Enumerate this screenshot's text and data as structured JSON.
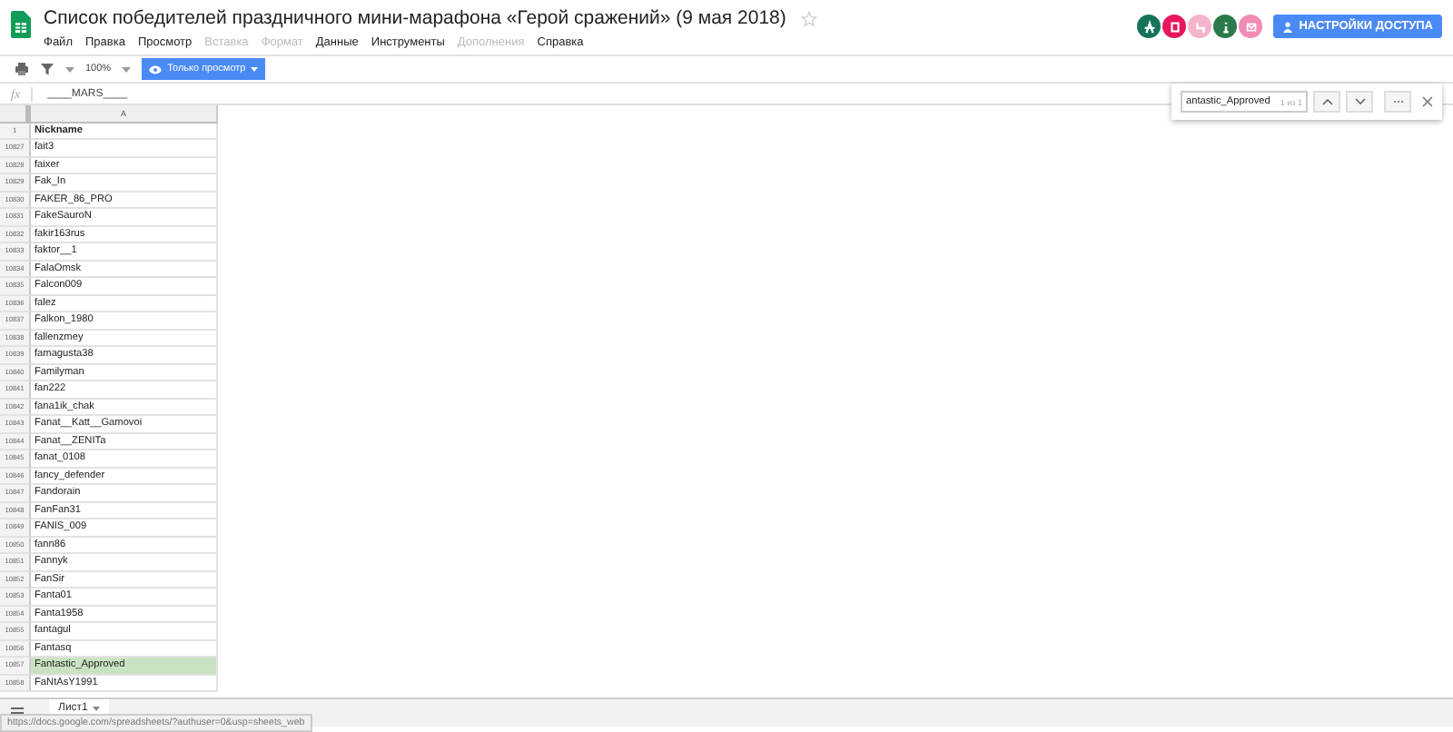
{
  "title": "Список победителей праздничного мини-марафона «Герой сражений» (9 мая 2018)",
  "menu": [
    {
      "label": "Файл",
      "disabled": false
    },
    {
      "label": "Правка",
      "disabled": false
    },
    {
      "label": "Просмотр",
      "disabled": false
    },
    {
      "label": "Вставка",
      "disabled": true
    },
    {
      "label": "Формат",
      "disabled": true
    },
    {
      "label": "Данные",
      "disabled": false
    },
    {
      "label": "Инструменты",
      "disabled": false
    },
    {
      "label": "Дополнения",
      "disabled": true
    },
    {
      "label": "Справка",
      "disabled": false
    }
  ],
  "avatars": [
    {
      "color": "#16735a"
    },
    {
      "color": "#e8175d"
    },
    {
      "color": "#f5b3cc"
    },
    {
      "color": "#2b7a4b"
    },
    {
      "color": "#f28bb4"
    }
  ],
  "share_button": "НАСТРОЙКИ ДОСТУПА",
  "toolbar": {
    "zoom": "100%",
    "mode": "Только просмотр"
  },
  "formula": {
    "fx": "fx",
    "value": "____MARS____"
  },
  "find": {
    "value": "antastic_Approved",
    "count": "1 из 1"
  },
  "sheet": {
    "column": "A",
    "header_row": {
      "number": "1",
      "value": "Nickname"
    },
    "rows": [
      {
        "number": "10827",
        "value": "fait3",
        "selected": false
      },
      {
        "number": "10828",
        "value": "faixer",
        "selected": false
      },
      {
        "number": "10829",
        "value": "Fak_In",
        "selected": false
      },
      {
        "number": "10830",
        "value": "FAKER_86_PRO",
        "selected": false
      },
      {
        "number": "10831",
        "value": "FakeSauroN",
        "selected": false
      },
      {
        "number": "10832",
        "value": "fakir163rus",
        "selected": false
      },
      {
        "number": "10833",
        "value": "faktor__1",
        "selected": false
      },
      {
        "number": "10834",
        "value": "FalaOmsk",
        "selected": false
      },
      {
        "number": "10835",
        "value": "Falcon009",
        "selected": false
      },
      {
        "number": "10836",
        "value": "falez",
        "selected": false
      },
      {
        "number": "10837",
        "value": "Falkon_1980",
        "selected": false
      },
      {
        "number": "10838",
        "value": "fallenzmey",
        "selected": false
      },
      {
        "number": "10839",
        "value": "famagusta38",
        "selected": false
      },
      {
        "number": "10840",
        "value": "Familyman",
        "selected": false
      },
      {
        "number": "10841",
        "value": "fan222",
        "selected": false
      },
      {
        "number": "10842",
        "value": "fana1ik_chak",
        "selected": false
      },
      {
        "number": "10843",
        "value": "Fanat__Katt__Gamovoi",
        "selected": false
      },
      {
        "number": "10844",
        "value": "Fanat__ZENITa",
        "selected": false
      },
      {
        "number": "10845",
        "value": "fanat_0108",
        "selected": false
      },
      {
        "number": "10846",
        "value": "fancy_defender",
        "selected": false
      },
      {
        "number": "10847",
        "value": "Fandorain",
        "selected": false
      },
      {
        "number": "10848",
        "value": "FanFan31",
        "selected": false
      },
      {
        "number": "10849",
        "value": "FANIS_009",
        "selected": false
      },
      {
        "number": "10850",
        "value": "fann86",
        "selected": false
      },
      {
        "number": "10851",
        "value": "Fannyk",
        "selected": false
      },
      {
        "number": "10852",
        "value": "FanSir",
        "selected": false
      },
      {
        "number": "10853",
        "value": "Fanta01",
        "selected": false
      },
      {
        "number": "10854",
        "value": "Fanta1958",
        "selected": false
      },
      {
        "number": "10855",
        "value": "fantagul",
        "selected": false
      },
      {
        "number": "10856",
        "value": "Fantasq",
        "selected": false
      },
      {
        "number": "10857",
        "value": "Fantastic_Approved",
        "selected": true
      },
      {
        "number": "10858",
        "value": "FaNtAsY1991",
        "selected": false
      }
    ]
  },
  "sheet_tab": "Лист1",
  "status_url": "https://docs.google.com/spreadsheets/?authuser=0&usp=sheets_web"
}
